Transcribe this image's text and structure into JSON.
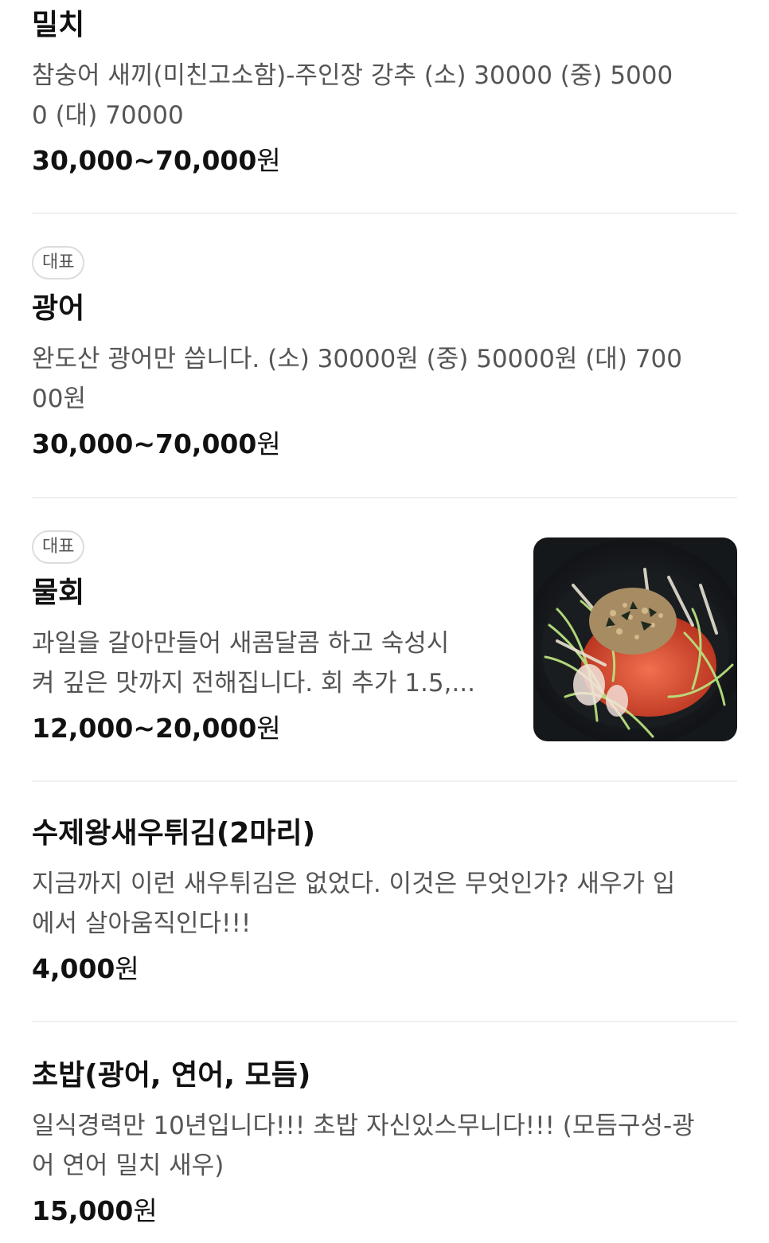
{
  "menu_items": [
    {
      "name": "밀치",
      "badge": "",
      "desc_line1": "참숭어 새끼(미친고소함)-주인장 강추 (소) 30000 (중) 5000",
      "desc_line2": "0 (대) 70000",
      "price": "30,000~70,000",
      "currency": "원"
    },
    {
      "name": "광어",
      "badge": "대표",
      "desc_line1": "완도산 광어만 씁니다. (소) 30000원 (중) 50000원 (대) 700",
      "desc_line2": "00원",
      "price": "30,000~70,000",
      "currency": "원"
    },
    {
      "name": "물회",
      "badge": "대표",
      "desc_line1": "과일을 갈아만들어 새콤달콤 하고 숙성시",
      "desc_line2": "켜 깊은 맛까지 전해집니다. 회 추가 1.5,...",
      "price": "12,000~20,000",
      "currency": "원",
      "photo_icon": "mulhoe-photo"
    },
    {
      "name": "수제왕새우튀김(2마리)",
      "badge": "",
      "desc_line1": "지금까지 이런 새우튀김은 없었다. 이것은 무엇인가? 새우가 입",
      "desc_line2": "에서 살아움직인다!!!",
      "price": "4,000",
      "currency": "원"
    },
    {
      "name": "초밥(광어, 연어, 모듬)",
      "badge": "",
      "desc_line1": "일식경력만 10년입니다!!! 초밥 자신있스무니다!!! (모듬구성-광",
      "desc_line2": "어 연어 밀치 새우)",
      "price": "15,000",
      "currency": "원"
    }
  ],
  "colors": {
    "text_primary": "#111111",
    "text_secondary": "#555555",
    "divider": "#f0f0f0",
    "badge_border": "#dcdcdc"
  }
}
